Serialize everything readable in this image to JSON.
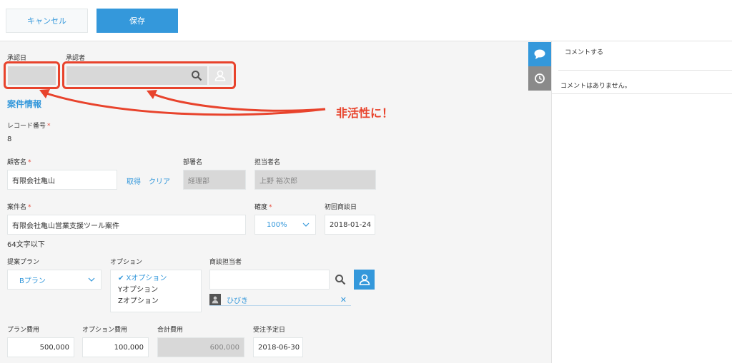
{
  "toolbar": {
    "cancel_label": "キャンセル",
    "save_label": "保存"
  },
  "approval": {
    "date_label": "承認日",
    "approver_label": "承認者"
  },
  "section_title": "案件情報",
  "record": {
    "label": "レコード番号",
    "value": "8"
  },
  "customer": {
    "label": "顧客名",
    "value": "有限会社亀山",
    "get_label": "取得",
    "clear_label": "クリア"
  },
  "department": {
    "label": "部署名",
    "value": "経理部"
  },
  "person": {
    "label": "担当者名",
    "value": "上野 裕次郎"
  },
  "case": {
    "label": "案件名",
    "value": "有限会社亀山営業支援ツール案件",
    "hint": "64文字以下"
  },
  "certainty": {
    "label": "確度",
    "value": "100%"
  },
  "first_meeting": {
    "label": "初回商談日",
    "value": "2018-01-24"
  },
  "plan": {
    "label": "提案プラン",
    "value": "Bプラン"
  },
  "options": {
    "label": "オプション",
    "items": [
      "✔ Xオプション",
      "Yオプション",
      "Zオプション"
    ]
  },
  "negotiator": {
    "label": "商談担当者",
    "user": "ひびき"
  },
  "plan_cost": {
    "label": "プラン費用",
    "value": "500,000"
  },
  "option_cost": {
    "label": "オプション費用",
    "value": "100,000"
  },
  "total_cost": {
    "label": "合計費用",
    "value": "600,000"
  },
  "order_date": {
    "label": "受注予定日",
    "value": "2018-06-30"
  },
  "comments": {
    "post_label": "コメントする",
    "empty_label": "コメントはありません。"
  },
  "annotation": {
    "text": "非活性に！"
  },
  "colors": {
    "accent": "#3498db",
    "annotation": "#e8432c"
  }
}
